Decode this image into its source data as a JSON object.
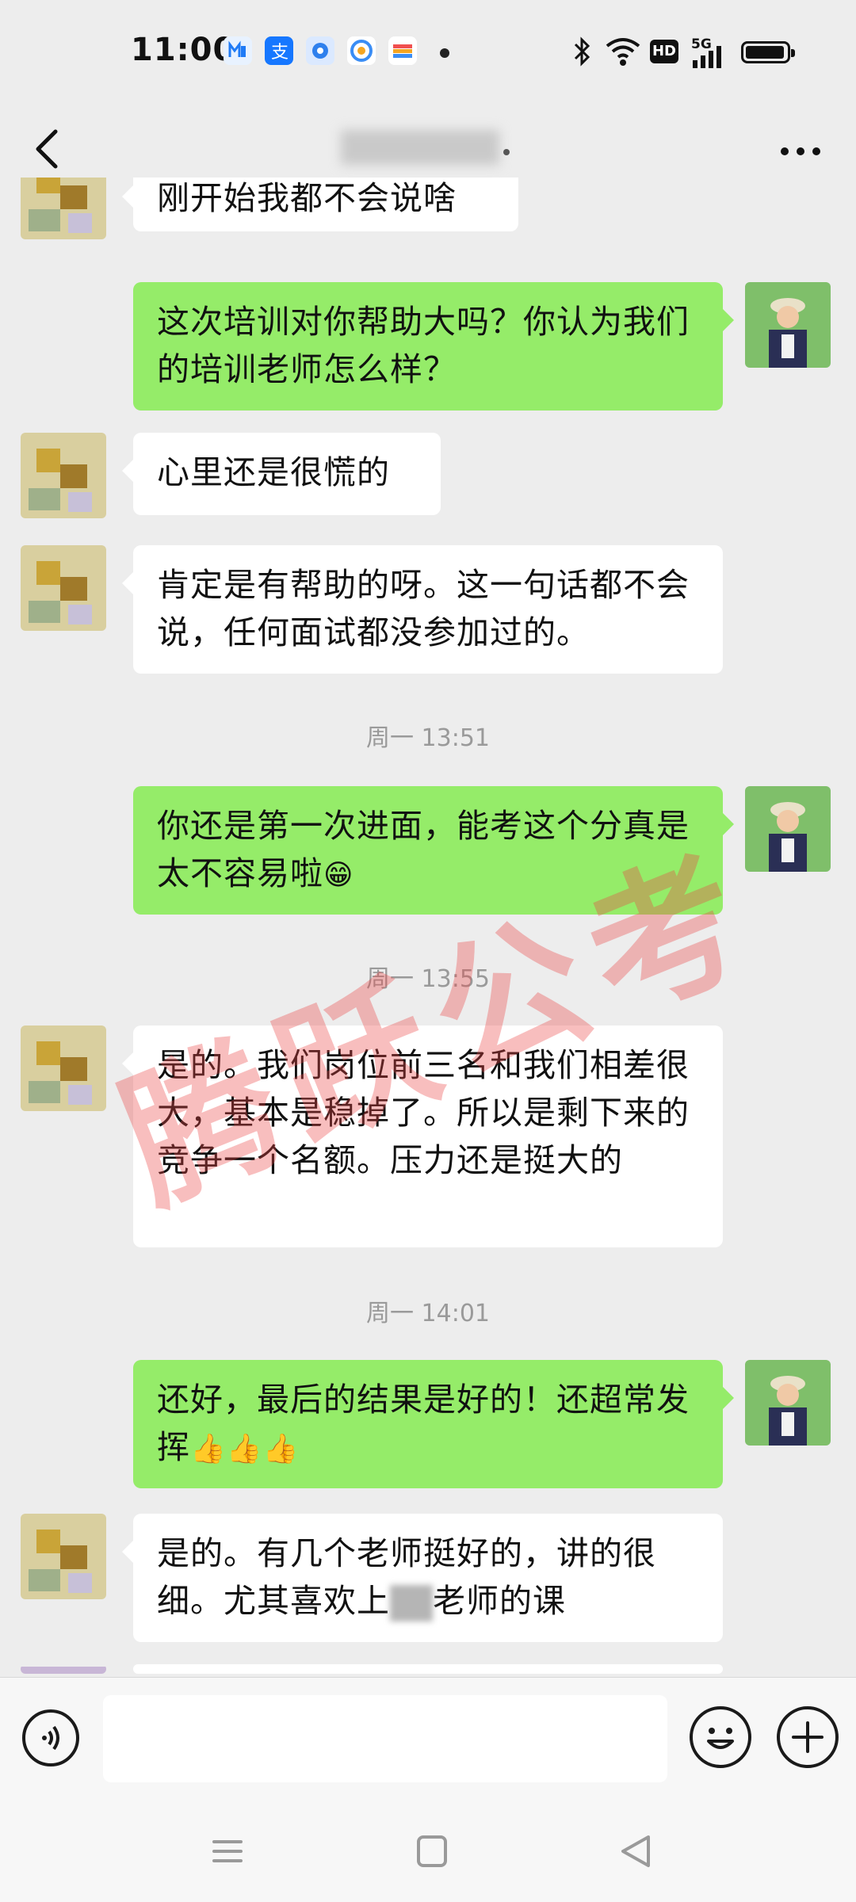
{
  "status_bar": {
    "time": "11:00",
    "hd_label": "HD",
    "network_label": "5G"
  },
  "header": {
    "contact_name": "",
    "back_icon": "chevron-left-icon",
    "more_icon": "more-dots-icon"
  },
  "messages": [
    {
      "side": "left",
      "text": "刚开始我都不会说啥"
    },
    {
      "side": "right",
      "text": "这次培训对你帮助大吗？你认为我们的培训老师怎么样？"
    },
    {
      "side": "left",
      "text": "心里还是很慌的"
    },
    {
      "side": "left",
      "text": "肯定是有帮助的呀。这一句话都不会说，任何面试都没参加过的。"
    },
    {
      "type": "timestamp",
      "text": "周一 13:51"
    },
    {
      "side": "right",
      "text": "你还是第一次进面，能考这个分真是太不容易啦",
      "emoji": "😁"
    },
    {
      "type": "timestamp",
      "text": "周一 13:55"
    },
    {
      "side": "left",
      "text": "是的。我们岗位前三名和我们相差很大，基本是稳掉了。所以是剩下来的竞争一个名额。压力还是挺大的"
    },
    {
      "type": "timestamp",
      "text": "周一 14:01"
    },
    {
      "side": "right",
      "text": "还好，最后的结果是好的！还超常发挥",
      "emoji": "👍👍👍"
    },
    {
      "side": "left",
      "text_before": "是的。有几个老师挺好的，讲的很细。尤其喜欢上",
      "text_after": "老师的课"
    }
  ],
  "watermark": "腾跃公考",
  "input_bar": {
    "placeholder": "",
    "voice_icon": "voice-icon",
    "emoji_icon": "emoji-icon",
    "plus_icon": "plus-icon"
  },
  "colors": {
    "background": "#ededed",
    "bubble_self": "#95ec69",
    "bubble_other": "#ffffff",
    "timestamp": "#9a9a9a"
  }
}
